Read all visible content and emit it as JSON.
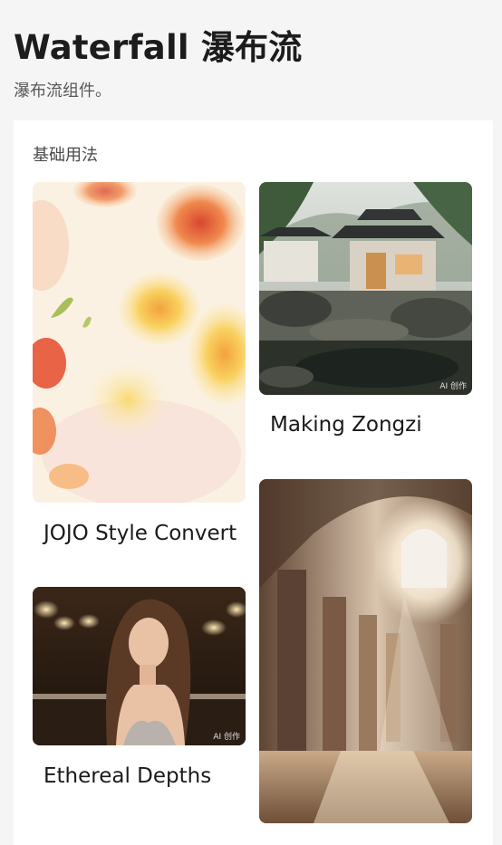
{
  "header": {
    "title": "Waterfall 瀑布流",
    "description": "瀑布流组件。"
  },
  "section": {
    "title": "基础用法"
  },
  "items": [
    {
      "caption": "JOJO Style Convert",
      "image": "watercolor-flowers-image",
      "badge": ""
    },
    {
      "caption": "Making Zongzi",
      "image": "chinese-garden-pavilion-image",
      "badge": "AI 创作"
    },
    {
      "caption": "Ethereal Depths",
      "image": "woman-portrait-image",
      "badge": "AI 创作"
    },
    {
      "caption": "",
      "image": "sunlit-palace-hall-image",
      "badge": ""
    }
  ]
}
